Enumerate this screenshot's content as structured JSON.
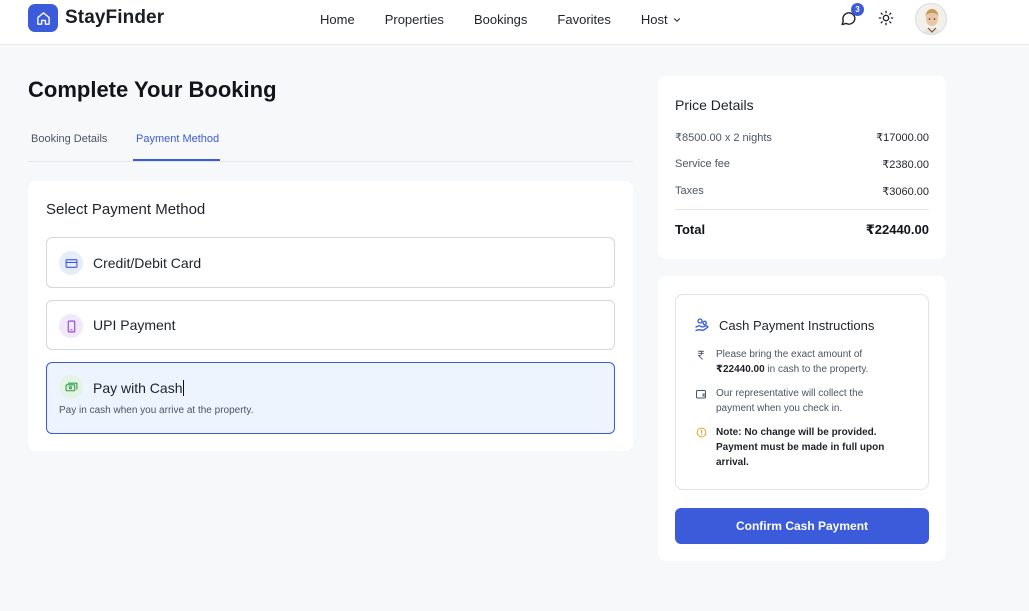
{
  "header": {
    "brand": "StayFinder",
    "nav": [
      "Home",
      "Properties",
      "Bookings",
      "Favorites",
      "Host"
    ],
    "message_badge": "3"
  },
  "main": {
    "title": "Complete Your Booking",
    "tabs": [
      {
        "label": "Booking Details",
        "active": false
      },
      {
        "label": "Payment Method",
        "active": true
      }
    ],
    "payment": {
      "title": "Select Payment Method",
      "options": [
        {
          "label": "Credit/Debit Card",
          "icon": "credit-card-icon"
        },
        {
          "label": "UPI Payment",
          "icon": "smartphone-icon"
        },
        {
          "label": "Pay with Cash",
          "icon": "cash-icon",
          "selected": true,
          "description": "Pay in cash when you arrive at the property."
        }
      ]
    }
  },
  "price": {
    "title": "Price Details",
    "rows": [
      {
        "label": "₹8500.00 x 2 nights",
        "value": "₹17000.00"
      },
      {
        "label": "Service fee",
        "value": "₹2380.00"
      },
      {
        "label": "Taxes",
        "value": "₹3060.00"
      }
    ],
    "total_label": "Total",
    "total_value": "₹22440.00"
  },
  "cash": {
    "title": "Cash Payment Instructions",
    "line1_pre": "Please bring the exact amount of",
    "line1_amount": "₹22440.00",
    "line1_post": " in cash to the property.",
    "line2": "Our representative will collect the payment when you check in.",
    "line3": "Note: No change will be provided. Payment must be made in full upon arrival.",
    "confirm_label": "Confirm Cash Payment"
  },
  "colors": {
    "accent": "#3b5bdb",
    "selected_bg": "#edf4fe",
    "note_icon": "#e0a526"
  }
}
